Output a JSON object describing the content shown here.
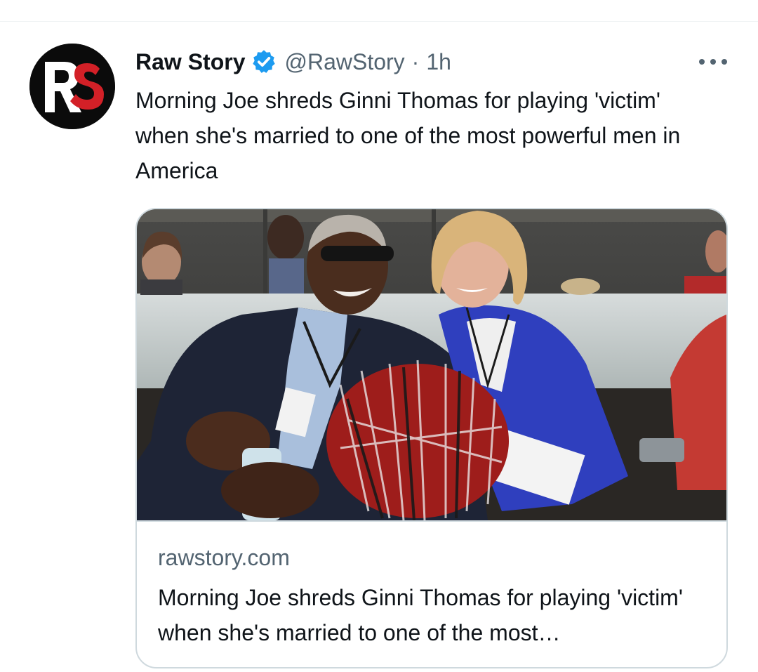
{
  "tweet": {
    "author": {
      "display_name": "Raw Story",
      "handle": "@RawStory",
      "verified": true,
      "avatar_letters": "RS"
    },
    "separator": "·",
    "time": "1h",
    "text": "Morning Joe shreds Ginni Thomas for playing 'victim' when she's married to one of the most powerful men in America",
    "card": {
      "domain": "rawstory.com",
      "title": "Morning Joe shreds Ginni Thomas for playing 'victim' when she's married to one of the most…"
    }
  },
  "icons": {
    "verified": "verified-badge-icon",
    "more": "more-options-icon"
  },
  "colors": {
    "verified_blue": "#1d9bf0",
    "secondary_text": "#536471",
    "primary_text": "#0f1419",
    "card_border": "#cfd9de",
    "logo_red": "#d32027"
  }
}
